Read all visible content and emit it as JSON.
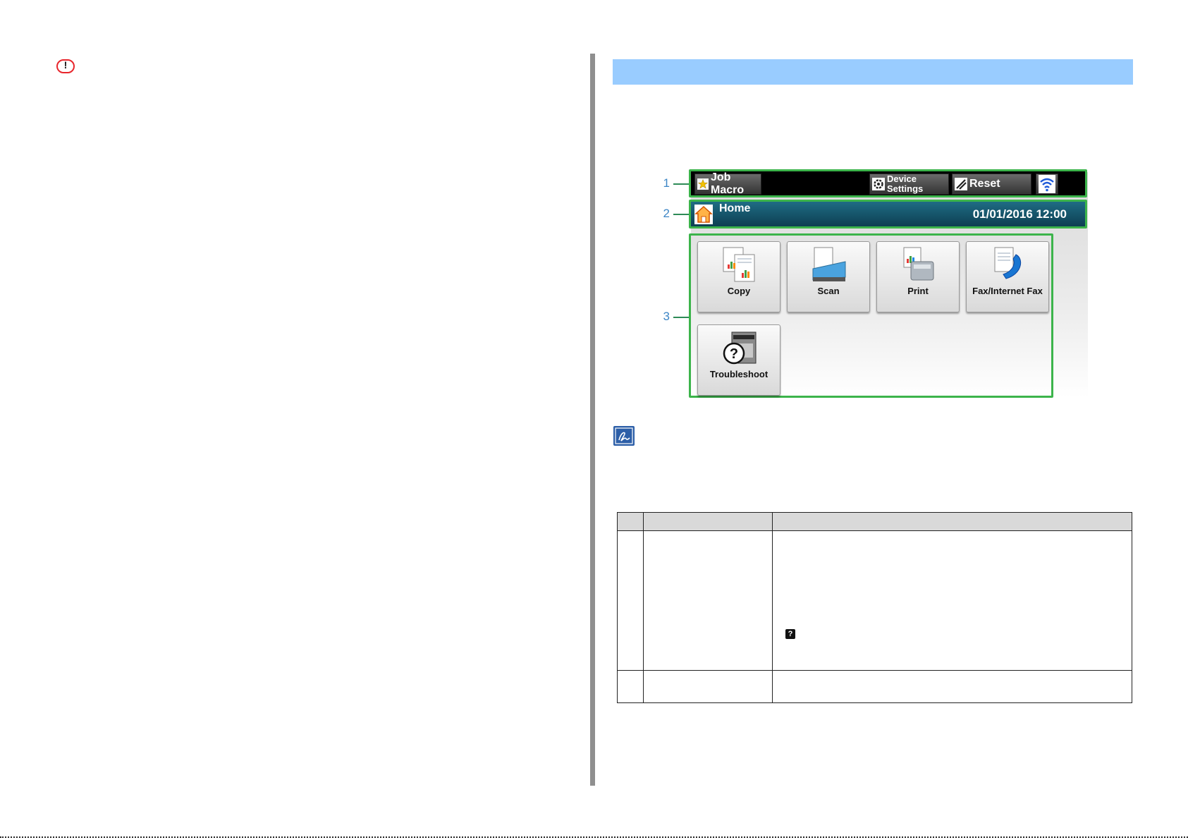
{
  "panel": {
    "topbar": {
      "job_macro": "Job Macro",
      "device_line1": "Device",
      "device_line2": "Settings",
      "reset": "Reset",
      "wifi_icon": "wifi-icon"
    },
    "homebar": {
      "title": "Home",
      "datetime": "01/01/2016 12:00"
    },
    "tiles": [
      {
        "label": "Copy",
        "icon": "copy-icon"
      },
      {
        "label": "Scan",
        "icon": "scan-icon"
      },
      {
        "label": "Print",
        "icon": "print-icon"
      },
      {
        "label": "Fax/Internet Fax",
        "icon": "fax-icon"
      },
      {
        "label": "Troubleshoot",
        "icon": "troubleshoot-icon"
      }
    ]
  },
  "callouts": [
    "1",
    "2",
    "3"
  ],
  "colors": {
    "section_bar": "#99ccff",
    "highlight_border": "#3cb44b",
    "callout_text": "#3d86c6",
    "warning": "#e8262c",
    "note": "#2d5fa8"
  },
  "icons": {
    "warning": "warning-icon",
    "note": "note-pen-icon",
    "help": "question-icon"
  },
  "help_glyph": "?"
}
